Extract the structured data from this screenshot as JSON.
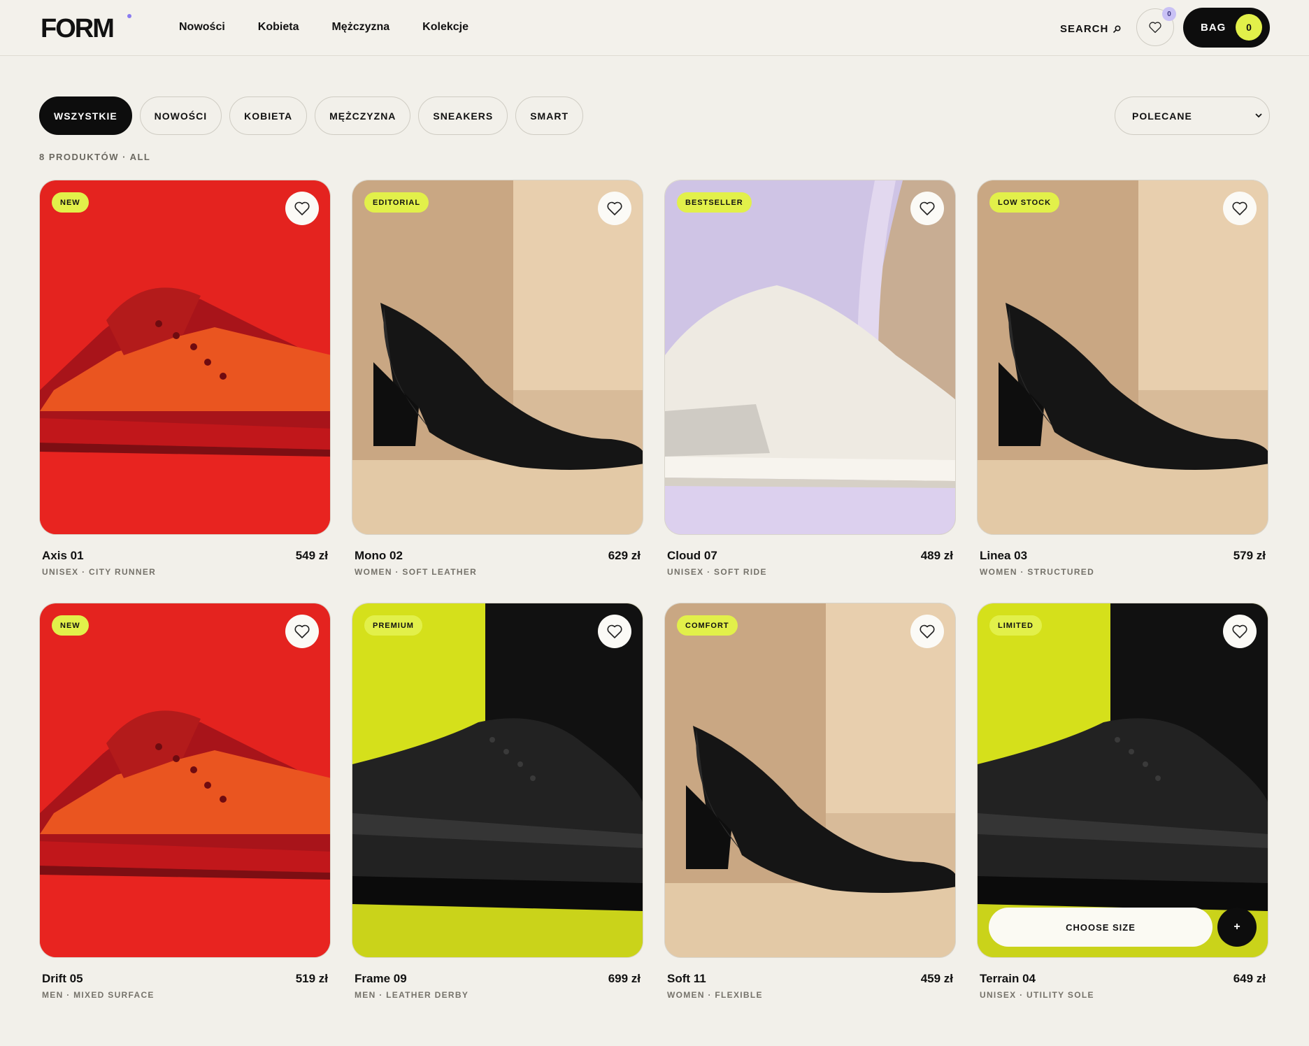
{
  "header": {
    "logo": "FORM",
    "nav": [
      "Nowości",
      "Kobieta",
      "Mężczyzna",
      "Kolekcje"
    ],
    "search_label": "SEARCH",
    "wishlist_count": "0",
    "bag_label": "BAG",
    "bag_count": "0"
  },
  "filters": [
    "WSZYSTKIE",
    "NOWOŚCI",
    "KOBIETA",
    "MĘŻCZYZNA",
    "SNEAKERS",
    "SMART"
  ],
  "active_filter": "WSZYSTKIE",
  "sort": {
    "value": "POLECANE"
  },
  "results_line": "8 PRODUKTÓW · ALL",
  "products": [
    {
      "name": "Axis 01",
      "price": "549 zł",
      "sub": "UNISEX · CITY RUNNER",
      "badge": "NEW",
      "scene": "red-sneaker"
    },
    {
      "name": "Mono 02",
      "price": "629 zł",
      "sub": "WOMEN · SOFT LEATHER",
      "badge": "EDITORIAL",
      "scene": "black-pump"
    },
    {
      "name": "Cloud 07",
      "price": "489 zł",
      "sub": "UNISEX · SOFT RIDE",
      "badge": "BESTSELLER",
      "scene": "white-sneaker"
    },
    {
      "name": "Linea 03",
      "price": "579 zł",
      "sub": "WOMEN · STRUCTURED",
      "badge": "LOW STOCK",
      "scene": "black-pump"
    },
    {
      "name": "Drift 05",
      "price": "519 zł",
      "sub": "MEN · MIXED SURFACE",
      "badge": "NEW",
      "scene": "red-sneaker"
    },
    {
      "name": "Frame 09",
      "price": "699 zł",
      "sub": "MEN · LEATHER DERBY",
      "badge": "PREMIUM",
      "scene": "derby"
    },
    {
      "name": "Soft 11",
      "price": "459 zł",
      "sub": "WOMEN · FLEXIBLE",
      "badge": "COMFORT",
      "scene": "black-pump"
    },
    {
      "name": "Terrain 04",
      "price": "649 zł",
      "sub": "UNISEX · UTILITY SOLE",
      "badge": "LIMITED",
      "scene": "derby"
    }
  ],
  "hover_card": {
    "choose_size_label": "CHOOSE SIZE",
    "plus_label": "+"
  },
  "colors": {
    "accent": "#e2f04a",
    "dark": "#0d0d0d",
    "background": "#f2f0ea"
  }
}
